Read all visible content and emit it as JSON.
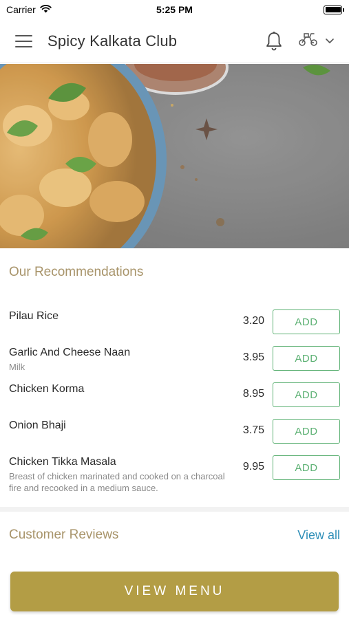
{
  "status_bar": {
    "carrier": "Carrier",
    "time": "5:25 PM"
  },
  "header": {
    "title": "Spicy Kalkata Club",
    "icons": [
      "menu-icon",
      "bell-icon",
      "delivery-scooter-icon",
      "chevron-down-icon"
    ]
  },
  "recommendations": {
    "title": "Our Recommendations",
    "add_label": "ADD",
    "items": [
      {
        "name": "Pilau Rice",
        "description": "",
        "price": "3.20"
      },
      {
        "name": "Garlic And Cheese Naan",
        "description": "Milk",
        "price": "3.95"
      },
      {
        "name": "Chicken Korma",
        "description": "",
        "price": "8.95"
      },
      {
        "name": "Onion Bhaji",
        "description": "",
        "price": "3.75"
      },
      {
        "name": "Chicken Tikka Masala",
        "description": "Breast of chicken marinated and cooked on a charcoal fire and recooked in a medium sauce.",
        "price": "9.95"
      }
    ]
  },
  "reviews": {
    "title": "Customer Reviews",
    "view_all_label": "View all"
  },
  "footer": {
    "view_menu_label": "VIEW MENU"
  },
  "colors": {
    "accent_gold": "#b39d45",
    "section_title": "#a8946a",
    "add_green": "#5bb072",
    "link_blue": "#2f8fb8"
  }
}
